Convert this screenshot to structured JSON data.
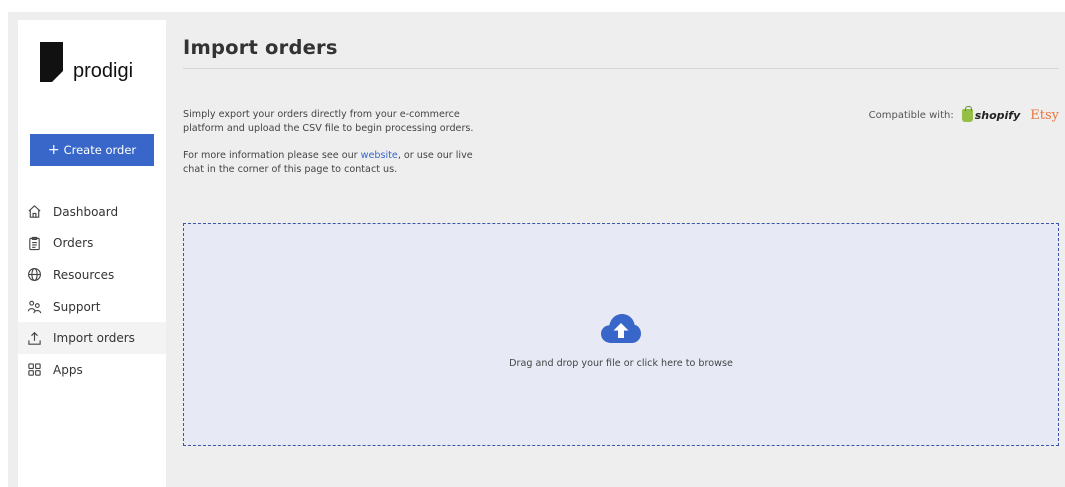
{
  "brand": {
    "name": "prodigi"
  },
  "sidebar": {
    "create_label": "Create order",
    "create_icon": "+",
    "items": [
      {
        "label": "Dashboard",
        "icon": "home-icon"
      },
      {
        "label": "Orders",
        "icon": "clipboard-icon"
      },
      {
        "label": "Resources",
        "icon": "globe-icon"
      },
      {
        "label": "Support",
        "icon": "people-icon"
      },
      {
        "label": "Import orders",
        "icon": "upload-icon",
        "active": true
      },
      {
        "label": "Apps",
        "icon": "grid-icon"
      }
    ]
  },
  "main": {
    "title": "Import orders",
    "intro_line1": "Simply export your orders directly from your e-commerce platform and upload the CSV file to begin processing orders.",
    "intro_line2_pre": "For more information please see our ",
    "intro_link": "website",
    "intro_line2_post": ", or use our live chat in the corner of this page to contact us.",
    "compatible_label": "Compatible with:",
    "shopify_label": "shopify",
    "etsy_label": "Etsy",
    "dropzone_text": "Drag and drop your file or click here to browse"
  },
  "colors": {
    "accent": "#3867c9",
    "dropzone_border": "#3c54a8",
    "dropzone_bg": "#e7eaf4",
    "shopify_green": "#95bf47",
    "etsy_orange": "#e8743b"
  }
}
